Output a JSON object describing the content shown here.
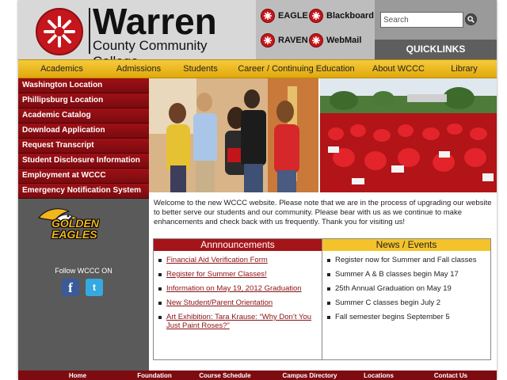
{
  "logo": {
    "name": "Warren",
    "subtitle": "County Community College"
  },
  "portals": [
    {
      "label": "EAGLE",
      "icon": "wccc-star-icon"
    },
    {
      "label": "Blackboard",
      "icon": "wccc-star-icon"
    },
    {
      "label": "RAVEN",
      "icon": "wccc-star-icon"
    },
    {
      "label": "WebMail",
      "icon": "wccc-star-icon"
    }
  ],
  "search": {
    "placeholder": "Search",
    "value": "Search",
    "icon": "search-icon"
  },
  "quicklinks": "QUICKLINKS",
  "nav": [
    "Academics",
    "Admissions",
    "Students",
    "Career / Continuing Education",
    "About WCCC",
    "Library"
  ],
  "sidebar": {
    "items": [
      "Washington Location",
      "Phillipsburg Location",
      "Academic Catalog",
      "Download Application",
      "Request Transcript",
      "Student Disclosure Information",
      "Employment at WCCC",
      "Emergency Notification System"
    ],
    "mascot_text": "GOLDEN EAGLES",
    "follow": "Follow WCCC ON",
    "social": [
      {
        "name": "facebook",
        "glyph": "f"
      },
      {
        "name": "twitter",
        "glyph": "t"
      }
    ]
  },
  "welcome": "Welcome to the new WCCC website. Please note that we are in the process of upgrading our website to better serve our students and our community. Please bear with us as we continue to make enhancements and check back with us frequently. Thank you for visiting us!",
  "announcements": {
    "title": "Annnouncements",
    "items": [
      "Financial Aid Verification Form",
      "Register for Summer Classes!",
      "Information on May 19, 2012 Graduation",
      "New Student/Parent Orientation",
      "Art Exhibition: Tara Krause: “Why Don’t You Just Paint Roses?”"
    ]
  },
  "news": {
    "title": "News / Events",
    "items": [
      "Register now for Summer  and Fall classes",
      "Summer A & B classes begin May 17",
      "25th Annual Graduation on May 19",
      "Summer C classes begin July 2",
      "Fall semester begins September 5"
    ]
  },
  "footer": [
    "Home",
    "Foundation",
    "Course Schedule",
    "Campus Directory",
    "Locations",
    "Contact Us"
  ],
  "colors": {
    "brand_red": "#a4151a",
    "gold": "#f4c32c",
    "gray": "#5a5a5a"
  }
}
